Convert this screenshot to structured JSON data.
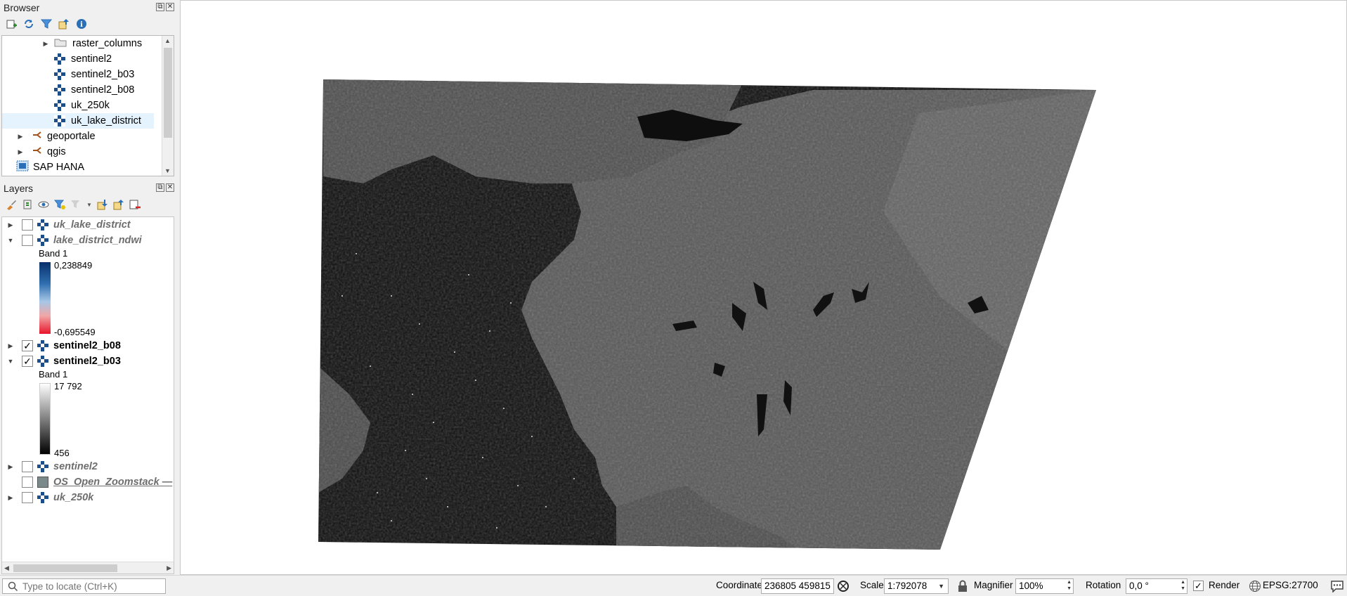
{
  "browser": {
    "title": "Browser",
    "items": [
      {
        "label": "raster_columns",
        "icon": "folder-icon"
      },
      {
        "label": "sentinel2",
        "icon": "raster-icon"
      },
      {
        "label": "sentinel2_b03",
        "icon": "raster-icon"
      },
      {
        "label": "sentinel2_b08",
        "icon": "raster-icon"
      },
      {
        "label": "uk_250k",
        "icon": "raster-icon"
      },
      {
        "label": "uk_lake_district",
        "icon": "raster-icon"
      },
      {
        "label": "geoportale",
        "icon": "schema-icon"
      },
      {
        "label": "qgis",
        "icon": "schema-icon"
      },
      {
        "label": "SAP HANA",
        "icon": "database-icon"
      }
    ]
  },
  "layers": {
    "title": "Layers",
    "items": [
      {
        "label": "uk_lake_district",
        "checked": false
      },
      {
        "label": "lake_district_ndwi",
        "checked": false,
        "legend": {
          "band": "Band 1",
          "max": "0,238849",
          "min": "-0,695549"
        }
      },
      {
        "label": "sentinel2_b08",
        "checked": true
      },
      {
        "label": "sentinel2_b03",
        "checked": true,
        "legend": {
          "band": "Band 1",
          "max": "17 792",
          "min": "456"
        }
      },
      {
        "label": "sentinel2",
        "checked": false
      },
      {
        "label": "OS_Open_Zoomstack —",
        "checked": false
      },
      {
        "label": "uk_250k",
        "checked": false
      }
    ]
  },
  "status": {
    "locate_placeholder": "Type to locate (Ctrl+K)",
    "coordinate_label": "Coordinate",
    "coordinate_value": "236805 459815",
    "scale_label": "Scale",
    "scale_value": "1:792078",
    "magnifier_label": "Magnifier",
    "magnifier_value": "100%",
    "rotation_label": "Rotation",
    "rotation_value": "0,0 °",
    "render_label": "Render",
    "render_checked": true,
    "crs": "EPSG:27700"
  }
}
